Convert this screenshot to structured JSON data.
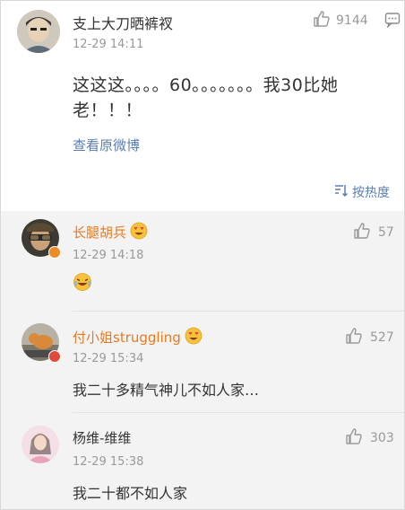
{
  "post": {
    "user": "支上大刀晒裤衩",
    "time": "12-29 14:11",
    "likes": "9144",
    "text": "这这这。。。。60。。。。。。。我30比她老！！！",
    "view_original": "查看原微博",
    "sort_label": "按热度"
  },
  "replies": [
    {
      "user": "长腿胡兵",
      "time": "12-29 14:18",
      "likes": "57",
      "content": ""
    },
    {
      "user": "付小姐struggling",
      "time": "12-29 15:34",
      "likes": "527",
      "content": "我二十多精气神儿不如人家…"
    },
    {
      "user": "杨维-维维",
      "time": "12-29 15:38",
      "likes": "303",
      "content": "我二十都不如人家"
    }
  ],
  "colors": {
    "link": "#5b7fb0",
    "vip_name": "#e8791f",
    "reply_bg": "#f3f3f3",
    "muted": "#999999"
  },
  "icons": [
    "thumbs-up-icon",
    "comment-icon",
    "sort-icon",
    "heart-eyes-emoji",
    "laugh-cry-emoji",
    "verified-badge-icon"
  ]
}
